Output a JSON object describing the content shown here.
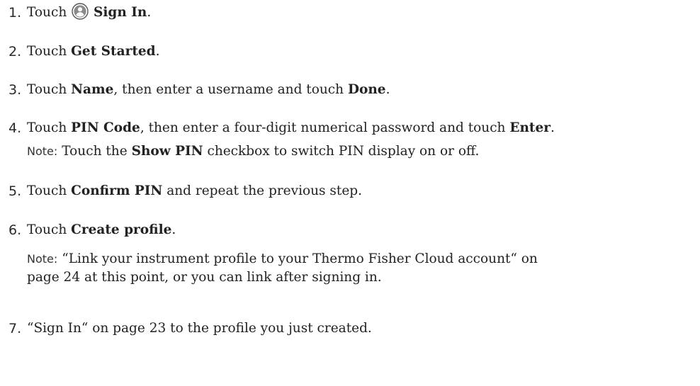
{
  "steps": [
    {
      "num": "1.",
      "pre": "Touch",
      "bold": "Sign In",
      "post": "."
    },
    {
      "num": "2.",
      "pre": "Touch",
      "bold": "Get Started",
      "post": "."
    },
    {
      "num": "3.",
      "pre": "Touch",
      "bold": "Name",
      "mid": ", then enter a username and touch",
      "bold2": "Done",
      "post": "."
    },
    {
      "num": "4.",
      "pre": "Touch",
      "bold": "PIN Code",
      "mid": ", then enter a four-digit numerical password and touch",
      "bold2": "Enter",
      "post": "."
    },
    {
      "num": "5.",
      "pre": "Touch",
      "bold": "Confirm PIN",
      "post": " and repeat the previous step."
    },
    {
      "num": "6.",
      "pre": "Touch",
      "bold": "Create profile",
      "post": "."
    },
    {
      "num": "7.",
      "text": "“Sign In“ on page 23 to the profile you just created."
    }
  ],
  "notes": {
    "note1": {
      "label": "Note:",
      "pre": "Touch the",
      "bold": "Show PIN",
      "post": " checkbox to switch PIN display on or off."
    },
    "note2": {
      "label": "Note:",
      "line1": "“Link your instrument profile to your Thermo Fisher Cloud account“ on",
      "line2": "page 24 at this point, or you can link after signing in."
    }
  },
  "icon": "user-circle-icon",
  "colors": {
    "text": "#222222",
    "icon_fill": "#8a8a8a"
  }
}
